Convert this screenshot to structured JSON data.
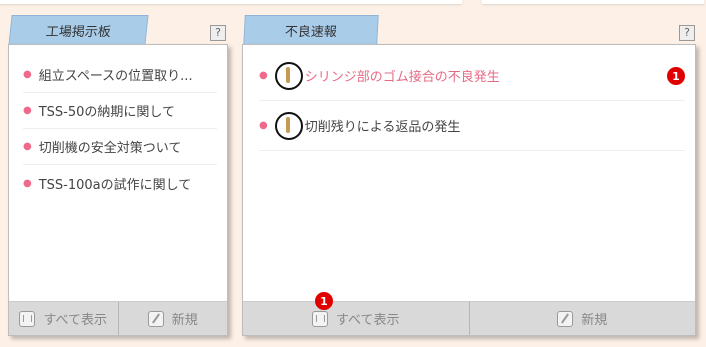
{
  "left_panel": {
    "tab": "工場掲示板",
    "help": "?",
    "items": [
      {
        "label": "組立スペースの位置取り..."
      },
      {
        "label": "TSS-50の納期に関して"
      },
      {
        "label": "切削機の安全対策ついて"
      },
      {
        "label": "TSS-100aの試作に関して"
      }
    ],
    "footer": {
      "show_all": "すべて表示",
      "new": "新規"
    }
  },
  "right_panel": {
    "tab": "不良速報",
    "help": "?",
    "items": [
      {
        "label": "シリンジ部のゴム接合の不良発生",
        "badge": "1"
      },
      {
        "label": "切削残りによる返品の発生"
      }
    ],
    "footer": {
      "show_all": "すべて表示",
      "show_all_badge": "1",
      "new": "新規"
    }
  },
  "colors": {
    "background": "#fdf1e7",
    "tab": "#a9cce9",
    "accent_link": "#e66b86",
    "badge": "#e00000"
  }
}
